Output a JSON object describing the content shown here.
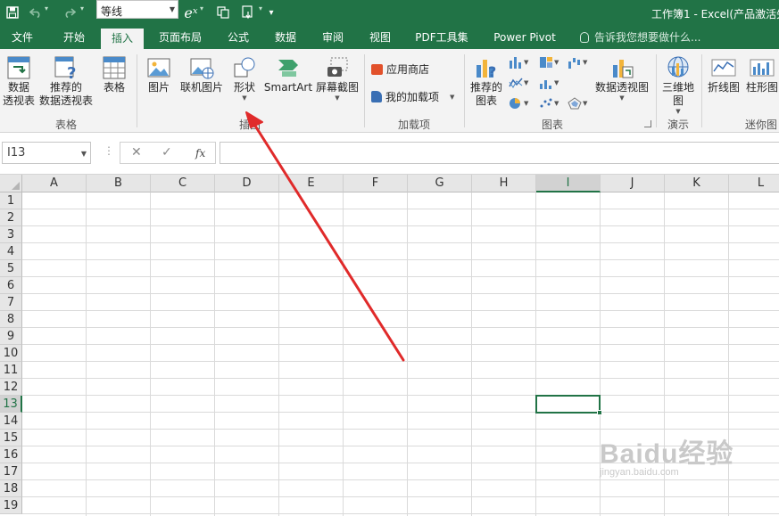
{
  "colors": {
    "brand": "#217346",
    "ribbon_bg": "#f3f3f3",
    "grid_line": "#dadada",
    "annotation_arrow": "#e02a2a"
  },
  "qat": {
    "save_icon": "save-icon",
    "undo_icon": "undo-icon",
    "redo_icon": "redo-icon",
    "font_name": "等线",
    "equation_icon": "equation-icon",
    "equation_symbol": "eˣ"
  },
  "window": {
    "title": "工作簿1 - Excel(产品激活失"
  },
  "tabs": [
    {
      "label": "文件"
    },
    {
      "label": "开始"
    },
    {
      "label": "插入",
      "active": true
    },
    {
      "label": "页面布局"
    },
    {
      "label": "公式"
    },
    {
      "label": "数据"
    },
    {
      "label": "审阅"
    },
    {
      "label": "视图"
    },
    {
      "label": "PDF工具集"
    },
    {
      "label": "Power Pivot"
    }
  ],
  "tell_me": {
    "placeholder": "告诉我您想要做什么..."
  },
  "ribbon": {
    "groups": {
      "tables": {
        "name": "表格",
        "pivot": "数据\n透视表",
        "recommended_pivot": "推荐的\n数据透视表",
        "table": "表格"
      },
      "illustrations": {
        "name": "插图",
        "pictures": "图片",
        "online_pictures": "联机图片",
        "shapes": "形状",
        "smartart": "SmartArt",
        "screenshot": "屏幕截图"
      },
      "addins": {
        "name": "加载项",
        "store": "应用商店",
        "my_addins": "我的加载项"
      },
      "charts": {
        "name": "图表",
        "recommended_charts": "推荐的\n图表",
        "pivot_chart": "数据透视图"
      },
      "tours": {
        "name": "演示",
        "map3d": "三维地\n图"
      },
      "sparklines": {
        "name": "迷你图",
        "line": "折线图",
        "column": "柱形图"
      }
    }
  },
  "formula_bar": {
    "name_box": "I13",
    "cancel": "✕",
    "enter": "✓",
    "fx": "fx",
    "formula": ""
  },
  "sheet": {
    "columns": [
      "A",
      "B",
      "C",
      "D",
      "E",
      "F",
      "G",
      "H",
      "I",
      "J",
      "K",
      "L"
    ],
    "rows": [
      "1",
      "2",
      "3",
      "4",
      "5",
      "6",
      "7",
      "8",
      "9",
      "10",
      "11",
      "12",
      "13",
      "14",
      "15",
      "16",
      "17",
      "18",
      "19"
    ],
    "selected_column": "I",
    "selected_row": "13",
    "active_cell": "I13"
  },
  "watermark": {
    "line1": "Baidu经验",
    "line2": "jingyan.baidu.com"
  }
}
